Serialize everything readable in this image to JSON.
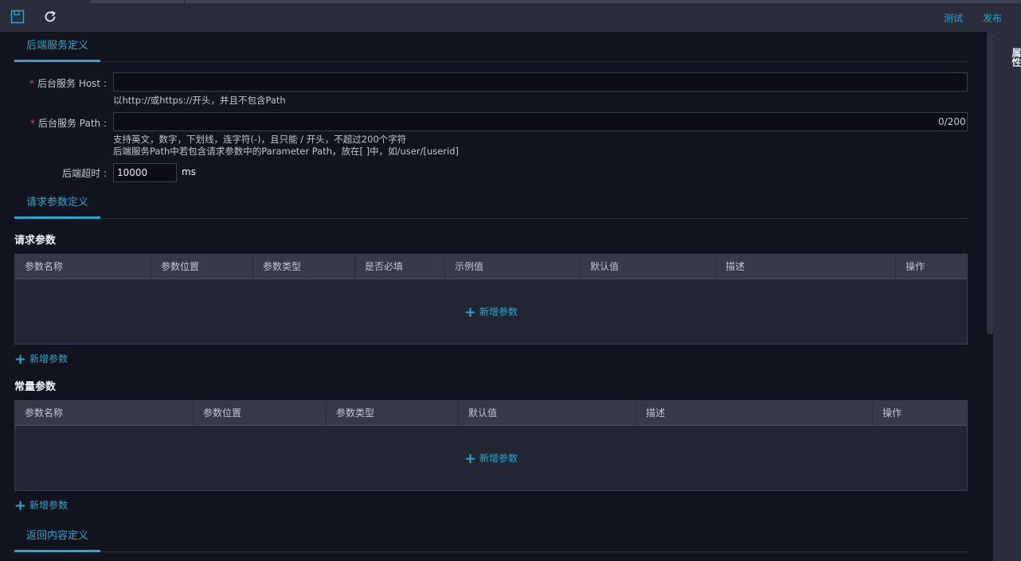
{
  "toolbar": {
    "actions": {
      "test": "测试",
      "publish": "发布"
    },
    "icons": [
      "save-icon",
      "refresh-icon"
    ]
  },
  "rail": {
    "label": "属性"
  },
  "backend_section": {
    "tab": "后端服务定义",
    "host": {
      "label": "后台服务 Host :",
      "required": "*",
      "value": "",
      "hint": "以http://或https://开头，并且不包含Path"
    },
    "path": {
      "label": "后台服务 Path :",
      "required": "*",
      "value": "",
      "counter": "0/200",
      "hint_line1": "支持英文，数字，下划线，连字符(-)，且只能 / 开头，不超过200个字符",
      "hint_line2": "后端服务Path中若包含请求参数中的Parameter Path，放在[ ]中，如/user/[userid]"
    },
    "timeout": {
      "label": "后端超时 :",
      "value": "10000",
      "unit": "ms"
    }
  },
  "request_section": {
    "tab": "请求参数定义",
    "request_params": {
      "title": "请求参数",
      "columns": [
        "参数名称",
        "参数位置",
        "参数类型",
        "是否必填",
        "示例值",
        "默认值",
        "描述",
        "操作"
      ],
      "empty_add": "新增参数",
      "add_link": "新增参数"
    },
    "constant_params": {
      "title": "常量参数",
      "columns": [
        "参数名称",
        "参数位置",
        "参数类型",
        "默认值",
        "描述",
        "操作"
      ],
      "empty_add": "新增参数",
      "add_link": "新增参数"
    }
  },
  "response_section": {
    "tab": "返回内容定义"
  },
  "colors": {
    "accent": "#27a6d4",
    "required": "#e0483e",
    "background": "#11141d",
    "panel": "#2a2e3b"
  }
}
